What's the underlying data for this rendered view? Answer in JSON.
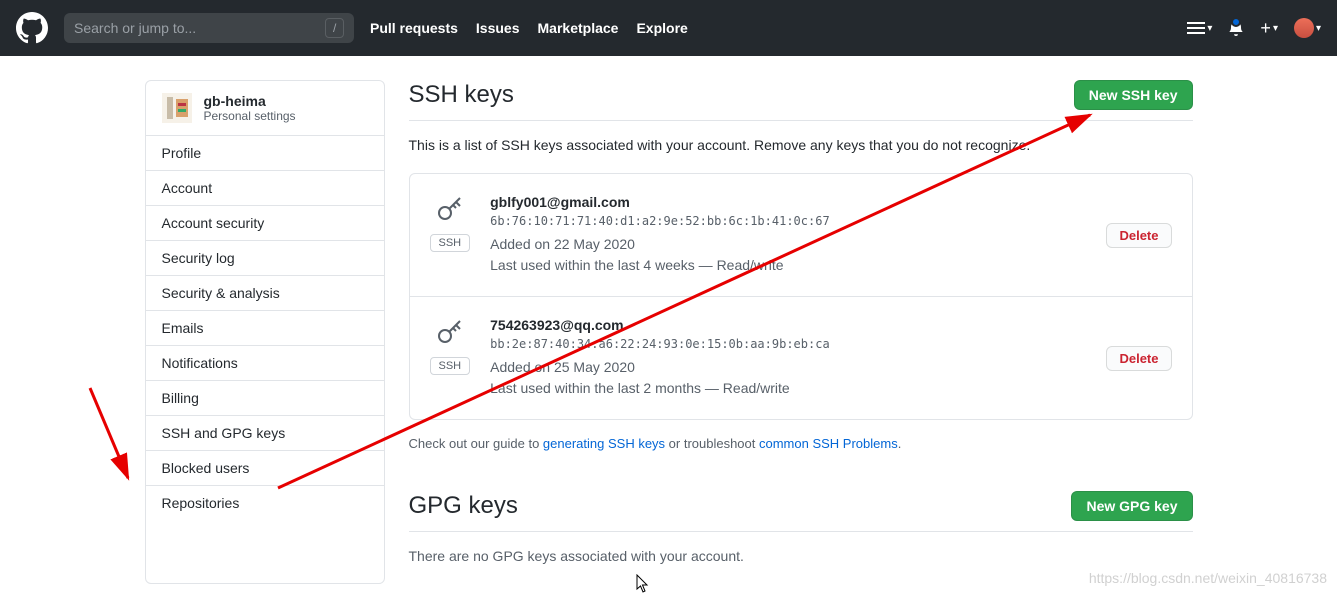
{
  "header": {
    "search_placeholder": "Search or jump to...",
    "nav": [
      "Pull requests",
      "Issues",
      "Marketplace",
      "Explore"
    ]
  },
  "sidebar": {
    "user": "gb-heima",
    "subtitle": "Personal settings",
    "items": [
      "Profile",
      "Account",
      "Account security",
      "Security log",
      "Security & analysis",
      "Emails",
      "Notifications",
      "Billing",
      "SSH and GPG keys",
      "Blocked users",
      "Repositories"
    ]
  },
  "ssh": {
    "title": "SSH keys",
    "new_btn": "New SSH key",
    "desc": "This is a list of SSH keys associated with your account. Remove any keys that you do not recognize.",
    "badge": "SSH",
    "delete_label": "Delete",
    "keys": [
      {
        "title": "gblfy001@gmail.com",
        "fingerprint": "6b:76:10:71:71:40:d1:a2:9e:52:bb:6c:1b:41:0c:67",
        "added": "Added on 22 May 2020",
        "used": "Last used within the last 4 weeks — Read/write"
      },
      {
        "title": "754263923@qq.com",
        "fingerprint": "bb:2e:87:40:34:a6:22:24:93:0e:15:0b:aa:9b:eb:ca",
        "added": "Added on 25 May 2020",
        "used": "Last used within the last 2 months — Read/write"
      }
    ],
    "hint_prefix": "Check out our guide to ",
    "hint_link1": "generating SSH keys",
    "hint_mid": " or troubleshoot ",
    "hint_link2": "common SSH Problems",
    "hint_suffix": "."
  },
  "gpg": {
    "title": "GPG keys",
    "new_btn": "New GPG key",
    "empty": "There are no GPG keys associated with your account."
  },
  "watermark": "https://blog.csdn.net/weixin_40816738"
}
